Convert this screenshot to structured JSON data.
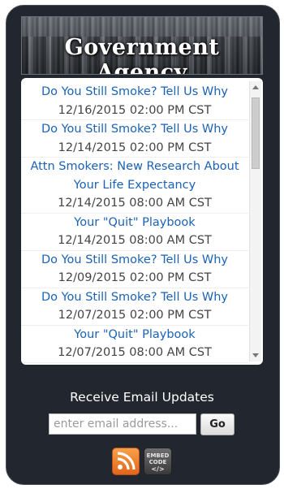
{
  "banner": {
    "title": "Government Agency"
  },
  "items": [
    {
      "title": "Do You Still Smoke? Tell Us Why",
      "date": "12/16/2015 02:00 PM CST"
    },
    {
      "title": "Do You Still Smoke? Tell Us Why",
      "date": "12/14/2015 02:00 PM CST"
    },
    {
      "title": "Attn Smokers: New Research About Your Life Expectancy",
      "date": "12/14/2015 08:00 AM CST"
    },
    {
      "title": "Your \"Quit\" Playbook",
      "date": "12/14/2015 08:00 AM CST"
    },
    {
      "title": "Do You Still Smoke? Tell Us Why",
      "date": "12/09/2015 02:00 PM CST"
    },
    {
      "title": "Do You Still Smoke? Tell Us Why",
      "date": "12/07/2015 02:00 PM CST"
    },
    {
      "title": "Your \"Quit\" Playbook",
      "date": "12/07/2015 08:00 AM CST"
    }
  ],
  "email": {
    "heading": "Receive Email Updates",
    "placeholder": "enter email address...",
    "go_label": "Go"
  },
  "footer": {
    "rss_icon": "rss-icon",
    "embed_line1": "EMBED",
    "embed_line2": "CODE",
    "embed_line3": "</>"
  }
}
